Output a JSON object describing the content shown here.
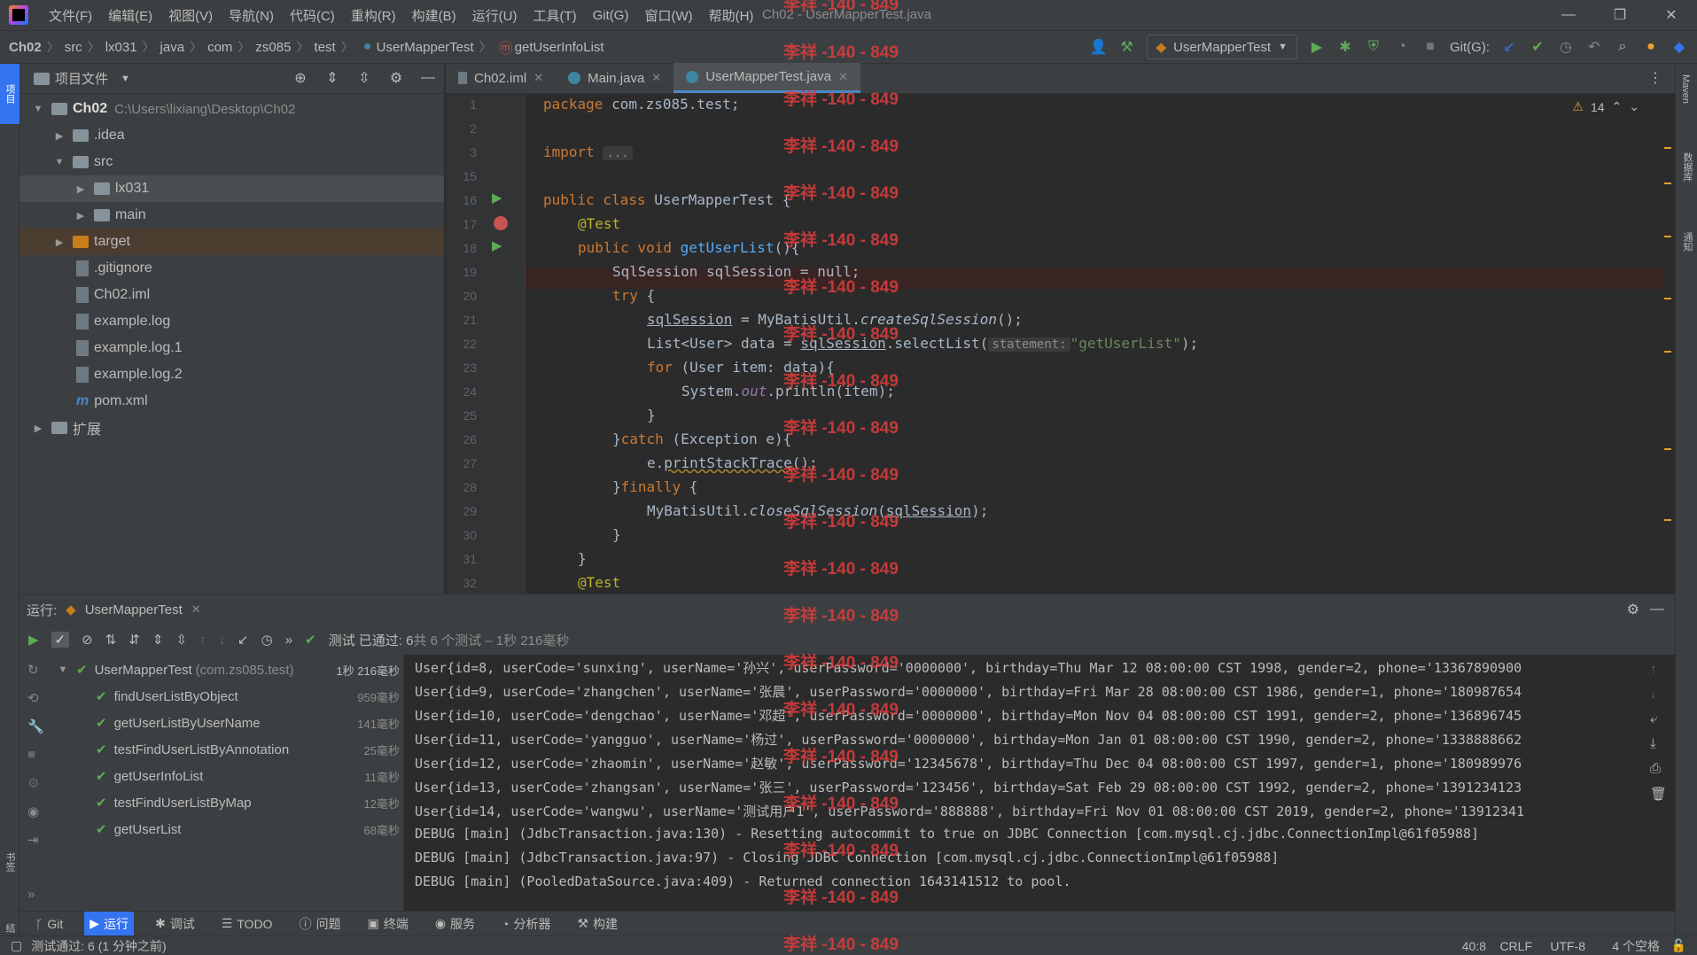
{
  "menubar": {
    "items": [
      "文件(F)",
      "编辑(E)",
      "视图(V)",
      "导航(N)",
      "代码(C)",
      "重构(R)",
      "构建(B)",
      "运行(U)",
      "工具(T)",
      "Git(G)",
      "窗口(W)",
      "帮助(H)"
    ],
    "title": "Ch02 - UserMapperTest.java"
  },
  "breadcrumb": [
    "Ch02",
    "src",
    "lx031",
    "java",
    "com",
    "zs085",
    "test",
    "UserMapperTest",
    "getUserInfoList"
  ],
  "toolbar": {
    "run_config": "UserMapperTest",
    "git_label": "Git(G):"
  },
  "left_strip": {
    "project_label": "项目",
    "bookmarks_label": "书签",
    "structure_label": "结构"
  },
  "right_strip": {
    "maven": "Maven",
    "database": "数据库",
    "notifications": "通知"
  },
  "project": {
    "header": "项目文件",
    "tree": [
      {
        "label": "Ch02",
        "path": "C:\\Users\\lixiang\\Desktop\\Ch02"
      },
      {
        "label": ".idea"
      },
      {
        "label": "src"
      },
      {
        "label": "lx031"
      },
      {
        "label": "main"
      },
      {
        "label": "target"
      },
      {
        "label": ".gitignore"
      },
      {
        "label": "Ch02.iml"
      },
      {
        "label": "example.log"
      },
      {
        "label": "example.log.1"
      },
      {
        "label": "example.log.2"
      },
      {
        "label": "pom.xml"
      },
      {
        "label": "扩展"
      }
    ]
  },
  "editor": {
    "tabs": [
      "Ch02.iml",
      "Main.java",
      "UserMapperTest.java"
    ],
    "warnings": "14",
    "line_numbers": [
      "1",
      "2",
      "3",
      "15",
      "16",
      "17",
      "18",
      "19",
      "20",
      "21",
      "22",
      "23",
      "24",
      "25",
      "26",
      "27",
      "28",
      "29",
      "30",
      "31",
      "32"
    ],
    "code": {
      "l1_kw": "package",
      "l1_rest": " com.zs085.test;",
      "l3_kw": "import",
      "l3_fold": "...",
      "l16_kw": "public class",
      "l16_rest": " UserMapperTest {",
      "l17": "@Test",
      "l18_kw": "public void",
      "l18_fn": "getUserList",
      "l18_rest": "(){",
      "l19": "SqlSession sqlSession = null;",
      "l20_kw": "try",
      "l20_rest": " {",
      "l21_a": "sqlSession",
      "l21_b": " = MyBatisUtil.",
      "l21_c": "createSqlSession",
      "l21_d": "();",
      "l22_a": "List<User> data = ",
      "l22_b": "sqlSession",
      "l22_c": ".selectList(",
      "l22_hint": "statement:",
      "l22_str": "\"getUserList\"",
      "l22_d": ");",
      "l23_kw": "for",
      "l23_rest": " (User item: data){",
      "l24_a": "System.",
      "l24_b": "out",
      "l24_c": ".println(item);",
      "l25": "}",
      "l26_a": "}",
      "l26_kw": "catch",
      "l26_rest": " (Exception e){",
      "l27_a": "e.",
      "l27_b": "printStackTrace",
      "l27_c": "();",
      "l28_a": "}",
      "l28_kw": "finally",
      "l28_rest": " {",
      "l29_a": "MyBatisUtil.",
      "l29_b": "closeSqlSession",
      "l29_c": "(",
      "l29_d": "sqlSession",
      "l29_e": ");",
      "l30": "}",
      "l31": "}",
      "l32": "@Test"
    }
  },
  "run": {
    "label": "运行:",
    "tab": "UserMapperTest",
    "status_prefix": "测试 已通过:",
    "status_count": "6",
    "status_rest": "共 6 个测试 – 1秒 216毫秒",
    "tests": [
      {
        "name": "UserMapperTest",
        "pkg": "(com.zs085.test)",
        "dur": "1秒 216毫秒"
      },
      {
        "name": "findUserListByObject",
        "dur": "959毫秒"
      },
      {
        "name": "getUserListByUserName",
        "dur": "141毫秒"
      },
      {
        "name": "testFindUserListByAnnotation",
        "dur": "25毫秒"
      },
      {
        "name": "getUserInfoList",
        "dur": "11毫秒"
      },
      {
        "name": "testFindUserListByMap",
        "dur": "12毫秒"
      },
      {
        "name": "getUserList",
        "dur": "68毫秒"
      }
    ],
    "console": [
      "User{id=8, userCode='sunxing', userName='孙兴', userPassword='0000000', birthday=Thu Mar 12 08:00:00 CST 1998, gender=2, phone='13367890900",
      "User{id=9, userCode='zhangchen', userName='张晨', userPassword='0000000', birthday=Fri Mar 28 08:00:00 CST 1986, gender=1, phone='180987654",
      "User{id=10, userCode='dengchao', userName='邓超', userPassword='0000000', birthday=Mon Nov 04 08:00:00 CST 1991, gender=2, phone='136896745",
      "User{id=11, userCode='yangguo', userName='杨过', userPassword='0000000', birthday=Mon Jan 01 08:00:00 CST 1990, gender=2, phone='1338888662",
      "User{id=12, userCode='zhaomin', userName='赵敏', userPassword='12345678', birthday=Thu Dec 04 08:00:00 CST 1997, gender=1, phone='180989976",
      "User{id=13, userCode='zhangsan', userName='张三', userPassword='123456', birthday=Sat Feb 29 08:00:00 CST 1992, gender=2, phone='1391234123",
      "User{id=14, userCode='wangwu', userName='测试用户1', userPassword='888888', birthday=Fri Nov 01 08:00:00 CST 2019, gender=2, phone='13912341",
      "DEBUG [main] (JdbcTransaction.java:130) - Resetting autocommit to true on JDBC Connection [com.mysql.cj.jdbc.ConnectionImpl@61f05988]",
      "DEBUG [main] (JdbcTransaction.java:97) - Closing JDBC Connection [com.mysql.cj.jdbc.ConnectionImpl@61f05988]",
      "DEBUG [main] (PooledDataSource.java:409) - Returned connection 1643141512 to pool."
    ]
  },
  "bottom_tools": [
    "Git",
    "运行",
    "调试",
    "TODO",
    "问题",
    "终端",
    "服务",
    "分析器",
    "构建"
  ],
  "statusbar": {
    "message": "测试通过: 6 (1 分钟之前)",
    "position": "40:8",
    "line_sep": "CRLF",
    "encoding": "UTF-8",
    "indent": "4 个空格"
  },
  "watermark": "李祥 -140 - 849",
  "colors": {
    "accent": "#3574f0",
    "pass": "#5faa56",
    "breakpoint": "#c75450",
    "watermark": "#e03c3c"
  }
}
